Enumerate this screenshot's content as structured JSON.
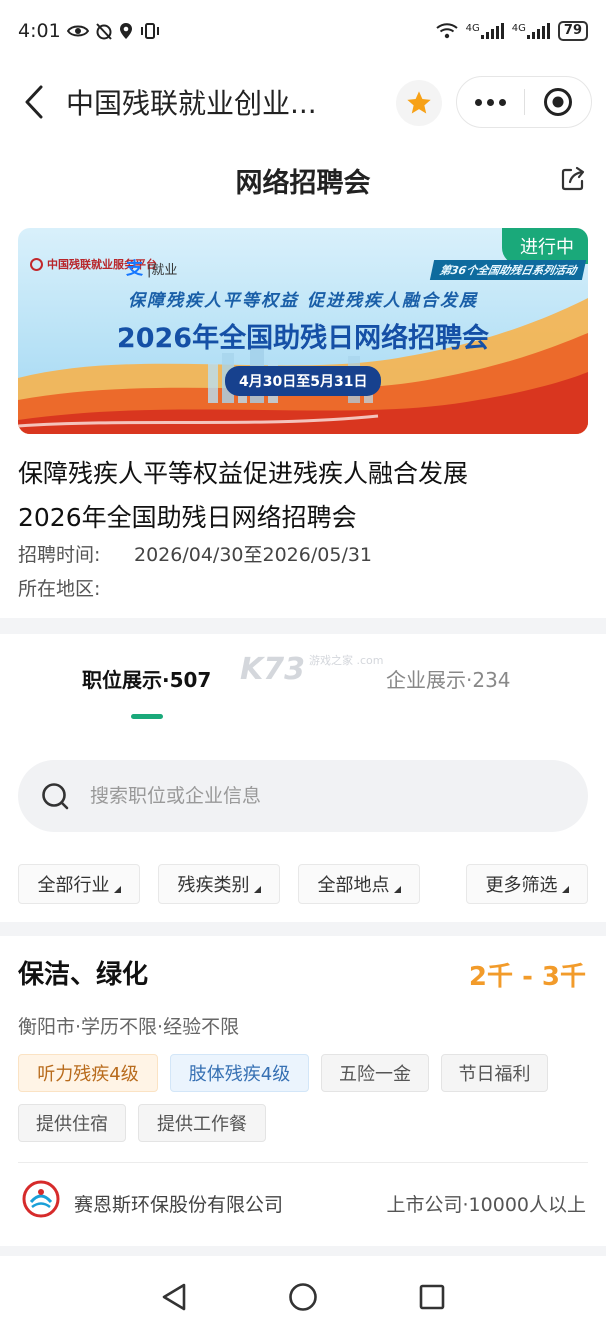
{
  "status_bar": {
    "time": "4:01",
    "network_1": "4G",
    "network_2": "4G",
    "battery": "79"
  },
  "nav": {
    "title": "中国残联就业创业..."
  },
  "page": {
    "title": "网络招聘会"
  },
  "banner": {
    "org": "中国残联就业服务平台",
    "partner": "就业",
    "status_tag": "进行中",
    "series": "第36个全国助残日系列活动",
    "slogan": "保障残疾人平等权益  促进残疾人融合发展",
    "headline": "2026年全国助残日网络招聘会",
    "date_range": "4月30日至5月31日"
  },
  "event": {
    "title_line1": "保障残疾人平等权益促进残疾人融合发展",
    "title_line2": "2026年全国助残日网络招聘会",
    "time_label": "招聘时间:",
    "time_value": "2026/04/30至2026/05/31",
    "region_label": "所在地区:",
    "region_value": ""
  },
  "tabs": [
    {
      "label": "职位展示·507"
    },
    {
      "label": "企业展示·234"
    }
  ],
  "watermark": {
    "brand": "K73",
    "sub": "游戏之家 .com"
  },
  "search": {
    "placeholder": "搜索职位或企业信息",
    "value": ""
  },
  "filters": [
    {
      "label": "全部行业"
    },
    {
      "label": "残疾类别"
    },
    {
      "label": "全部地点"
    },
    {
      "label": "更多筛选"
    }
  ],
  "job": {
    "title": "保洁、绿化",
    "salary": "2千 - 3千",
    "meta": "衡阳市·学历不限·经验不限",
    "tags": [
      "听力残疾4级",
      "肢体残疾4级",
      "五险一金",
      "节日福利",
      "提供住宿",
      "提供工作餐"
    ],
    "company_name": "赛恩斯环保股份有限公司",
    "company_info": "上市公司·10000人以上"
  },
  "colors": {
    "accent_green": "#1aa97a",
    "salary_orange": "#f29b2a",
    "favorite_orange": "#f7a116"
  }
}
